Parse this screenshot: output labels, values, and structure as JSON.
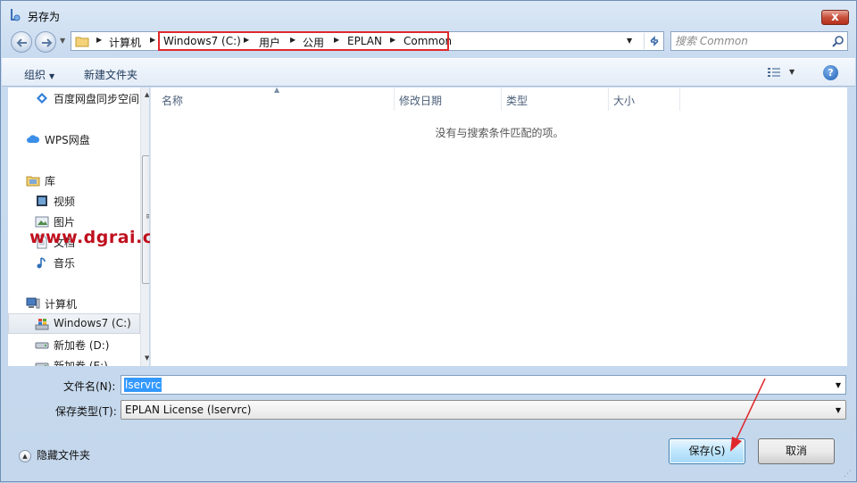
{
  "window": {
    "title": "另存为",
    "close_label": "x"
  },
  "address": {
    "crumbs": [
      "计算机",
      "Windows7 (C:)",
      "用户",
      "公用",
      "EPLAN",
      "Common"
    ]
  },
  "search": {
    "placeholder": "搜索 Common"
  },
  "toolbar": {
    "organize_label": "组织",
    "new_folder_label": "新建文件夹",
    "help_label": "?"
  },
  "navpane": {
    "items": [
      {
        "label": "百度网盘同步空间",
        "icon": "baidu-sync-icon"
      },
      {
        "label": "WPS网盘",
        "icon": "cloud-icon"
      },
      {
        "label": "库",
        "icon": "library-icon"
      },
      {
        "label": "视频",
        "icon": "video-icon"
      },
      {
        "label": "图片",
        "icon": "picture-icon"
      },
      {
        "label": "文档",
        "icon": "document-icon"
      },
      {
        "label": "音乐",
        "icon": "music-icon"
      },
      {
        "label": "计算机",
        "icon": "computer-icon"
      },
      {
        "label": "Windows7 (C:)",
        "icon": "windows-drive-icon"
      },
      {
        "label": "新加卷 (D:)",
        "icon": "drive-icon"
      },
      {
        "label": "新加卷 (E:)",
        "icon": "drive-icon"
      }
    ]
  },
  "watermark": "www.dgrai.com",
  "filelist": {
    "columns": [
      "名称",
      "修改日期",
      "类型",
      "大小"
    ],
    "empty_message": "没有与搜索条件匹配的项。"
  },
  "form": {
    "filename_label": "文件名(N):",
    "filename_value": "lservrc",
    "filetype_label": "保存类型(T):",
    "filetype_value": "EPLAN License (lservrc)"
  },
  "footer": {
    "hide_folders_label": "隐藏文件夹",
    "save_label": "保存(S)",
    "cancel_label": "取消"
  },
  "colors": {
    "highlight_box": "#e0282c",
    "arrow": "#e0282c",
    "selection": "#3399ff",
    "watermark": "#c0101e"
  }
}
